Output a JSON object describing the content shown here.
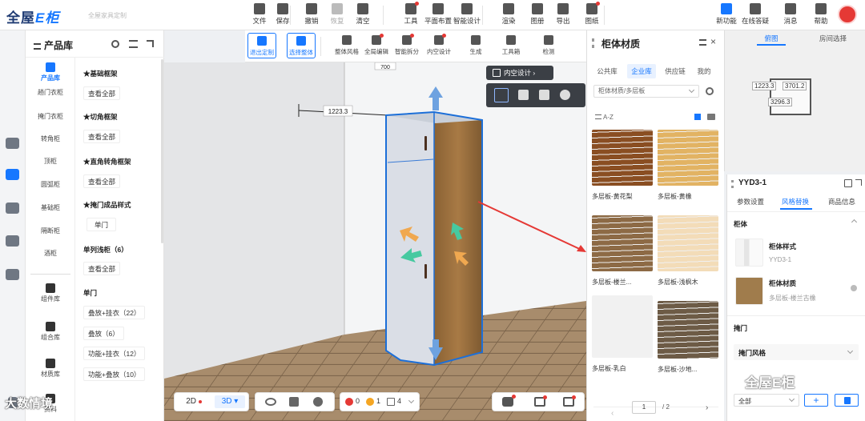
{
  "app": {
    "logo_main": "全屋",
    "logo_accent": "E柜",
    "subtitle": "全屋家具定制"
  },
  "toolbar": [
    {
      "label": "文件",
      "icon": "file-icon",
      "disabled": false,
      "dot": false
    },
    {
      "label": "保存",
      "icon": "save-icon",
      "disabled": false,
      "dot": false
    },
    {
      "label": "撤销",
      "icon": "undo-icon",
      "disabled": false,
      "dot": false
    },
    {
      "label": "恢复",
      "icon": "redo-icon",
      "disabled": true,
      "dot": false
    },
    {
      "label": "清空",
      "icon": "eraser-icon",
      "disabled": false,
      "dot": false
    },
    {
      "label": "工具",
      "icon": "wrench-icon",
      "disabled": false,
      "dot": true
    },
    {
      "label": "平面布置",
      "icon": "layout-icon",
      "disabled": false,
      "dot": false
    },
    {
      "label": "智能设计",
      "icon": "lightning-icon",
      "disabled": false,
      "dot": false
    },
    {
      "label": "渲染",
      "icon": "camera-icon",
      "disabled": false,
      "dot": false
    },
    {
      "label": "图册",
      "icon": "album-icon",
      "disabled": false,
      "dot": false
    },
    {
      "label": "导出",
      "icon": "export-icon",
      "disabled": false,
      "dot": false
    },
    {
      "label": "图纸",
      "icon": "drawing-icon",
      "disabled": false,
      "dot": true
    }
  ],
  "top_right": [
    {
      "label": "新功能",
      "icon": "new-feature-icon"
    },
    {
      "label": "在线答疑",
      "icon": "headset-icon"
    },
    {
      "label": "消息",
      "icon": "bell-icon"
    },
    {
      "label": "帮助",
      "icon": "help-icon"
    }
  ],
  "toolbar2": [
    {
      "label": "退出定制",
      "icon": "exit-icon",
      "selected": true,
      "dot": false
    },
    {
      "label": "选择整体",
      "icon": "select-all-icon",
      "selected": true,
      "dot": false
    },
    {
      "label": "整体风格",
      "icon": "style-icon",
      "selected": false,
      "dot": false
    },
    {
      "label": "全局编辑",
      "icon": "global-edit-icon",
      "selected": false,
      "dot": true
    },
    {
      "label": "智能拆分",
      "icon": "split-icon",
      "selected": false,
      "dot": true
    },
    {
      "label": "内空设计",
      "icon": "inner-design-icon",
      "selected": false,
      "dot": true
    },
    {
      "label": "生成",
      "icon": "generate-icon",
      "selected": false,
      "dot": false
    },
    {
      "label": "工具箱",
      "icon": "toolbox-icon",
      "selected": false,
      "dot": false
    },
    {
      "label": "检测",
      "icon": "check-icon",
      "selected": false,
      "dot": false
    }
  ],
  "product_panel": {
    "title": "产品库",
    "categories": [
      "产品库",
      "趟门衣柜",
      "掩门衣柜",
      "转角柜",
      "顶柜",
      "圆弧柜",
      "基础柜",
      "隔断柜",
      "酒柜"
    ],
    "bottom_categories": [
      "组件库",
      "组合库",
      "材质库",
      "资料"
    ],
    "sections": [
      {
        "title": "★基础框架",
        "buttons": [
          "查看全部"
        ]
      },
      {
        "title": "★切角框架",
        "buttons": [
          "查看全部"
        ]
      },
      {
        "title": "★直角转角框架",
        "buttons": [
          "查看全部"
        ]
      },
      {
        "title": "★掩门成品样式",
        "buttons": [
          "单门"
        ]
      },
      {
        "title": "单列浅柜（6）",
        "buttons": [
          "查看全部"
        ]
      },
      {
        "title": "单门",
        "buttons": [
          "叠放+挂衣（22）",
          "叠放（6）",
          "功能+挂衣（12）",
          "功能+叠放（10）"
        ]
      }
    ]
  },
  "canvas": {
    "dimension_width": "700",
    "dimension_height": "1223.3",
    "inner_design_label": "内空设计"
  },
  "material_panel": {
    "title": "柜体材质",
    "tabs": [
      "公共库",
      "企业库",
      "供应链",
      "我的"
    ],
    "active_tab": 1,
    "path": "柜体材质/多层板",
    "sort_label": "A-Z",
    "materials": [
      {
        "name": "多层板-黄花梨",
        "color": "#8a4e22"
      },
      {
        "name": "多层板-黄橡",
        "color": "#e2b363"
      },
      {
        "name": "多层板-楼兰...",
        "color": "#8d6a45"
      },
      {
        "name": "多层板-浅枫木",
        "color": "#f3dcb8"
      },
      {
        "name": "多层板-乳白",
        "color": "#f1f1f1"
      },
      {
        "name": "多层板-沙地...",
        "color": "#6d5b46"
      }
    ],
    "page_current": "1",
    "page_total": "/ 2"
  },
  "mini_map": {
    "tabs": [
      "俯图",
      "房间选择"
    ],
    "dim_a": "1223.3",
    "dim_b": "3701.2",
    "dim_c": "3296.3"
  },
  "properties": {
    "title": "YYD3-1",
    "tabs": [
      "参数设置",
      "风格替换",
      "商品信息"
    ],
    "active_tab": 1,
    "section_cabinet": "柜体",
    "style_label": "柜体样式",
    "style_value": "YYD3-1",
    "material_label": "柜体材质",
    "material_value": "多层板-楼兰古橡",
    "section_door": "掩门",
    "door_style_label": "掩门风格",
    "all_label": "全部"
  },
  "bottom": {
    "view_2d": "2D",
    "view_3d": "3D",
    "error_count": "0",
    "warn_count": "1",
    "item_count": "4"
  },
  "watermarks": {
    "left": "大数情境",
    "right": "全屋E柜"
  },
  "colors": {
    "accent": "#1677ff",
    "error": "#e53935",
    "warning": "#f5a623"
  }
}
